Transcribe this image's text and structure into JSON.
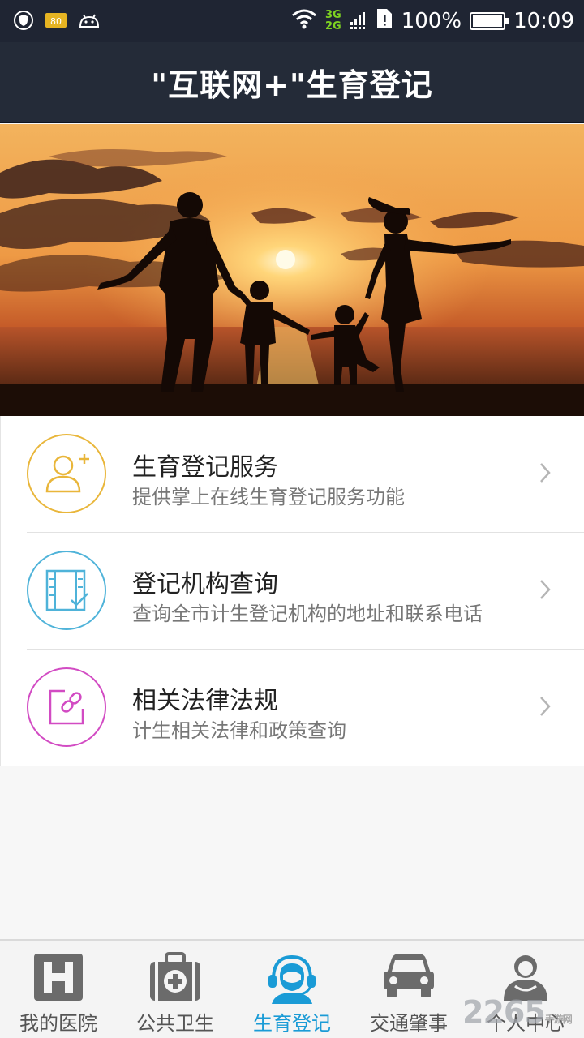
{
  "status_bar": {
    "net_top": "3G",
    "net_bottom": "2G",
    "battery": "100%",
    "time": "10:09",
    "badge": "80",
    "icons": [
      "shield-icon",
      "battery-saver-icon",
      "android-icon",
      "wifi-icon",
      "signal-icon",
      "sim-alert-icon",
      "battery-icon"
    ]
  },
  "header": {
    "title": "\"互联网+\"生育登记"
  },
  "menu": [
    {
      "title": "生育登记服务",
      "subtitle": "提供掌上在线生育登记服务功能",
      "icon": "add-user-icon",
      "color": "#e9b63a"
    },
    {
      "title": "登记机构查询",
      "subtitle": "查询全市计生登记机构的地址和联系电话",
      "icon": "checklist-icon",
      "color": "#4fb3d9"
    },
    {
      "title": "相关法律法规",
      "subtitle": "计生相关法律和政策查询",
      "icon": "link-icon",
      "color": "#d24bc3"
    }
  ],
  "bottom_nav": [
    {
      "label": "我的医院",
      "icon": "hospital-icon",
      "active": false
    },
    {
      "label": "公共卫生",
      "icon": "first-aid-kit-icon",
      "active": false
    },
    {
      "label": "生育登记",
      "icon": "headset-agent-icon",
      "active": true
    },
    {
      "label": "交通肇事",
      "icon": "car-icon",
      "active": false
    },
    {
      "label": "个人中心",
      "icon": "people-icon",
      "active": false
    }
  ],
  "colors": {
    "header_bg": "#242b38",
    "accent": "#1a9bd6",
    "chevron": "#b5b5b5"
  },
  "watermark": {
    "brand": "2265",
    "site": "手游网"
  }
}
